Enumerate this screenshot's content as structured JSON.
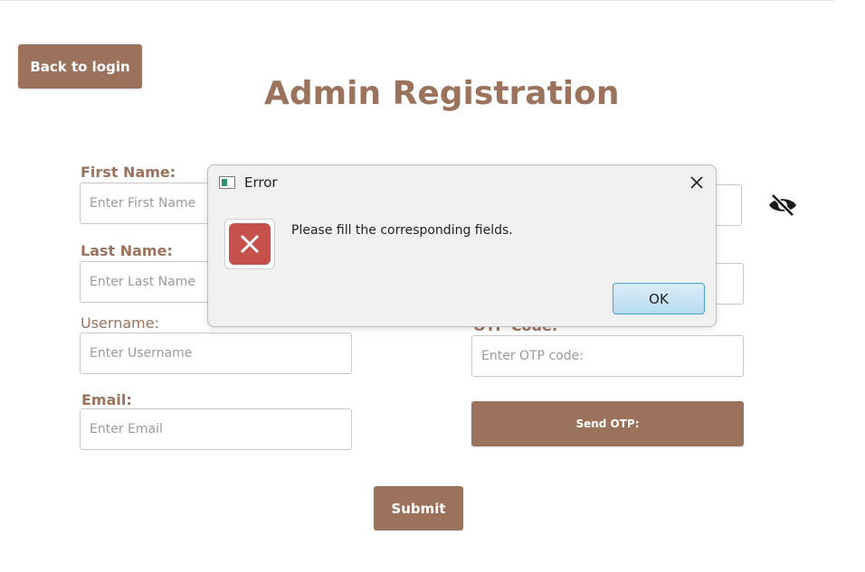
{
  "back_button": "Back to login",
  "title": "Admin Registration",
  "form": {
    "first_name": {
      "label": "First Name:",
      "placeholder": "Enter First Name"
    },
    "last_name": {
      "label": "Last Name:",
      "placeholder": "Enter Last Name"
    },
    "username": {
      "label": "Username:",
      "placeholder": "Enter Username"
    },
    "email": {
      "label": "Email:",
      "placeholder": "Enter Email"
    },
    "otp": {
      "label": "OTP Code:",
      "placeholder": "Enter OTP code:"
    },
    "send_otp": "Send OTP:",
    "submit": "Submit"
  },
  "dialog": {
    "title": "Error",
    "message": "Please fill the corresponding fields.",
    "ok": "OK"
  },
  "icons": {
    "eye": "eye-slash-icon",
    "close": "close-icon",
    "error": "error-icon",
    "window": "window-icon"
  },
  "colors": {
    "accent": "#9b725b",
    "error": "#c6504b"
  }
}
